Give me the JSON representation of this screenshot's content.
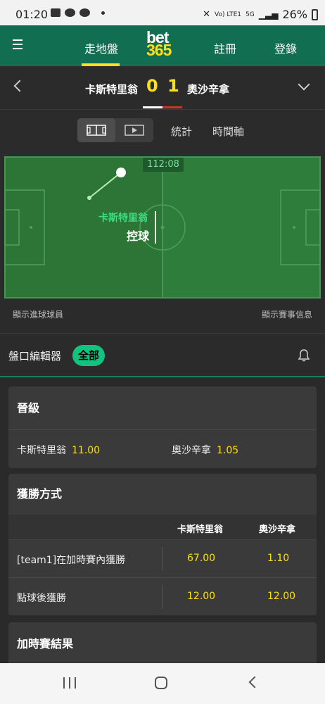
{
  "status_bar": {
    "time": "01:20",
    "network": "Vo) LTE1",
    "signal": "5G",
    "battery": "26%"
  },
  "header": {
    "live_label": "走地盤",
    "logo_top": "bet",
    "logo_bottom": "365",
    "register_label": "註冊",
    "login_label": "登錄",
    "brand_color": "#126e51",
    "accent_color": "#ffdf1b"
  },
  "match": {
    "home_team": "卡斯特里翁",
    "away_team": "奧沙辛拿",
    "home_score": "0",
    "away_score": "1"
  },
  "view_tabs": {
    "pitch_icon": "pitch-icon",
    "video_icon": "play-icon",
    "stats_label": "統計",
    "timeline_label": "時間軸"
  },
  "pitch": {
    "clock": "112:08",
    "possession_team": "卡斯特里翁",
    "possession_label": "控球",
    "show_scorers": "顯示進球球員",
    "show_info": "顯示賽事信息"
  },
  "market_editor": {
    "label": "盤口編輯器",
    "filter_all": "全部",
    "bell_icon": "bell-icon"
  },
  "markets": {
    "qualify": {
      "title": "晉級",
      "selections": [
        {
          "team": "卡斯特里翁",
          "odds": "11.00"
        },
        {
          "team": "奧沙辛拿",
          "odds": "1.05"
        }
      ]
    },
    "method_of_victory": {
      "title": "獲勝方式",
      "columns": [
        "卡斯特里翁",
        "奧沙辛拿"
      ],
      "rows": [
        {
          "name": "[team1]在加時賽內獲勝",
          "home": "67.00",
          "away": "1.10"
        },
        {
          "name": "點球後獲勝",
          "home": "12.00",
          "away": "12.00"
        }
      ]
    },
    "extra_time_result": {
      "title": "加時賽結果"
    }
  }
}
